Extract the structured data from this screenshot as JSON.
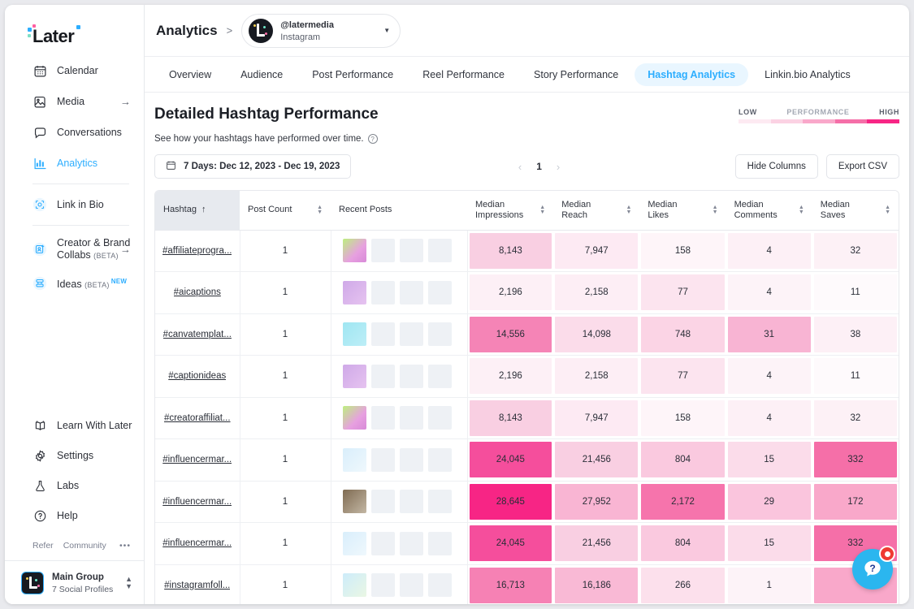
{
  "brand": {
    "logo_text": "Later",
    "accent": "#2daeff",
    "pink": "#f72585"
  },
  "sidebar": {
    "items": [
      {
        "label": "Calendar",
        "icon": "calendar-icon",
        "arrow": false,
        "active": false
      },
      {
        "label": "Media",
        "icon": "media-icon",
        "arrow": true,
        "active": false
      },
      {
        "label": "Conversations",
        "icon": "conversations-icon",
        "arrow": false,
        "active": false
      },
      {
        "label": "Analytics",
        "icon": "analytics-icon",
        "arrow": false,
        "active": true
      },
      {
        "label": "Link in Bio",
        "icon": "link-in-bio-icon",
        "arrow": false,
        "active": false
      },
      {
        "label": "Creator & Brand Collabs",
        "label2": "Collabs",
        "label1": "Creator & Brand",
        "badge": "(BETA)",
        "icon": "collabs-icon",
        "arrow": true,
        "active": false
      },
      {
        "label": "Ideas",
        "badge": "(BETA)",
        "new": "NEW",
        "icon": "ideas-icon",
        "arrow": false,
        "active": false
      }
    ],
    "bottom_items": [
      {
        "label": "Learn With Later",
        "icon": "book-icon"
      },
      {
        "label": "Settings",
        "icon": "gear-icon"
      },
      {
        "label": "Labs",
        "icon": "flask-icon"
      },
      {
        "label": "Help",
        "icon": "question-circle-icon"
      }
    ],
    "refer": "Refer",
    "community": "Community",
    "more_dots": "•••",
    "account": {
      "name": "Main Group",
      "subtitle": "7 Social Profiles"
    }
  },
  "header": {
    "breadcrumb_title": "Analytics",
    "breadcrumb_separator": ">",
    "account_handle": "@latermedia",
    "account_platform": "Instagram"
  },
  "tabs": [
    {
      "label": "Overview",
      "active": false
    },
    {
      "label": "Audience",
      "active": false
    },
    {
      "label": "Post Performance",
      "active": false
    },
    {
      "label": "Reel Performance",
      "active": false
    },
    {
      "label": "Story Performance",
      "active": false
    },
    {
      "label": "Hashtag Analytics",
      "active": true
    },
    {
      "label": "Linkin.bio Analytics",
      "active": false
    }
  ],
  "page": {
    "title": "Detailed Hashtag Performance",
    "subtitle": "See how your hashtags have performed over time.",
    "help_icon": "?",
    "legend": {
      "low": "LOW",
      "mid": "PERFORMANCE",
      "high": "HIGH",
      "swatches": [
        "#fdeaf2",
        "#fbd2e3",
        "#f9a8ca",
        "#f56fa8",
        "#f72585"
      ]
    },
    "date_range": "7 Days: Dec 12, 2023 - Dec 19, 2023",
    "pager": {
      "prev": "‹",
      "page": "1",
      "next": "›"
    },
    "hide_columns": "Hide Columns",
    "export_csv": "Export CSV"
  },
  "table": {
    "columns": [
      {
        "label": "Hashtag",
        "sort": "asc",
        "key": "hashtag"
      },
      {
        "label": "Post Count",
        "sort": "both",
        "key": "post_count"
      },
      {
        "label": "Recent Posts",
        "sort": "none",
        "key": "recent_posts"
      },
      {
        "label": "Median Impressions",
        "line1": "Median",
        "line2": "Impressions",
        "sort": "both",
        "key": "median_impressions"
      },
      {
        "label": "Median Reach",
        "line1": "Median",
        "line2": "Reach",
        "sort": "both",
        "key": "median_reach"
      },
      {
        "label": "Median Likes",
        "line1": "Median",
        "line2": "Likes",
        "sort": "both",
        "key": "median_likes"
      },
      {
        "label": "Median Comments",
        "line1": "Median",
        "line2": "Comments",
        "sort": "both",
        "key": "median_comments"
      },
      {
        "label": "Median Saves",
        "line1": "Median",
        "line2": "Saves",
        "sort": "both",
        "key": "median_saves"
      }
    ],
    "rows": [
      {
        "hashtag": "#affiliateprogra...",
        "post_count": "1",
        "thumb": "t1",
        "median_impressions": "8,143",
        "mi_c": "#f9cfe2",
        "median_reach": "7,947",
        "mr_c": "#fdeaf3",
        "median_likes": "158",
        "ml_c": "#fef5f9",
        "median_comments": "4",
        "mc_c": "#fdf0f6",
        "median_saves": "32",
        "ms_c": "#fdf1f6"
      },
      {
        "hashtag": "#aicaptions",
        "post_count": "1",
        "thumb": "t2",
        "median_impressions": "2,196",
        "mi_c": "#fdf0f6",
        "median_reach": "2,158",
        "mr_c": "#fdeef5",
        "median_likes": "77",
        "ml_c": "#fce4ef",
        "median_comments": "4",
        "mc_c": "#fdf3f8",
        "median_saves": "11",
        "ms_c": "#fefafc"
      },
      {
        "hashtag": "#canvatemplat...",
        "post_count": "1",
        "thumb": "t3",
        "median_impressions": "14,556",
        "mi_c": "#f584b6",
        "median_reach": "14,098",
        "mr_c": "#fbdcea",
        "median_likes": "748",
        "ml_c": "#fbd4e5",
        "median_comments": "31",
        "mc_c": "#f8b4d3",
        "median_saves": "38",
        "ms_c": "#fdf0f6"
      },
      {
        "hashtag": "#captionideas",
        "post_count": "1",
        "thumb": "t2",
        "median_impressions": "2,196",
        "mi_c": "#fdf0f6",
        "median_reach": "2,158",
        "mr_c": "#fdeef5",
        "median_likes": "77",
        "ml_c": "#fce4ef",
        "median_comments": "4",
        "mc_c": "#fdf3f8",
        "median_saves": "11",
        "ms_c": "#fefafc"
      },
      {
        "hashtag": "#creatoraffiliat...",
        "post_count": "1",
        "thumb": "t1",
        "median_impressions": "8,143",
        "mi_c": "#f9cfe2",
        "median_reach": "7,947",
        "mr_c": "#fdeaf3",
        "median_likes": "158",
        "ml_c": "#fef5f9",
        "median_comments": "4",
        "mc_c": "#fdf0f6",
        "median_saves": "32",
        "ms_c": "#fdf1f6"
      },
      {
        "hashtag": "#influencermar...",
        "post_count": "1",
        "thumb": "t4",
        "median_impressions": "24,045",
        "mi_c": "#f54e9c",
        "median_reach": "21,456",
        "mr_c": "#f9cfe2",
        "median_likes": "804",
        "ml_c": "#fac9df",
        "median_comments": "15",
        "mc_c": "#fbdcea",
        "median_saves": "332",
        "ms_c": "#f56fa8"
      },
      {
        "hashtag": "#influencermar...",
        "post_count": "1",
        "thumb": "t5",
        "median_impressions": "28,645",
        "mi_c": "#f72585",
        "median_reach": "27,952",
        "mr_c": "#f9b5d3",
        "median_likes": "2,172",
        "ml_c": "#f674ac",
        "median_comments": "29",
        "mc_c": "#fac5dd",
        "median_saves": "172",
        "ms_c": "#f9a8ca"
      },
      {
        "hashtag": "#influencermar...",
        "post_count": "1",
        "thumb": "t4",
        "median_impressions": "24,045",
        "mi_c": "#f54e9c",
        "median_reach": "21,456",
        "mr_c": "#f9cfe2",
        "median_likes": "804",
        "ml_c": "#fac9df",
        "median_comments": "15",
        "mc_c": "#fbdcea",
        "median_saves": "332",
        "ms_c": "#f56fa8"
      },
      {
        "hashtag": "#instagramfoll...",
        "post_count": "1",
        "thumb": "t6",
        "median_impressions": "16,713",
        "mi_c": "#f681b4",
        "median_reach": "16,186",
        "mr_c": "#f9b9d5",
        "median_likes": "266",
        "ml_c": "#fce0ec",
        "median_comments": "1",
        "mc_c": "#fdf3f8",
        "median_saves": "",
        "ms_c": "#f9a8ca"
      }
    ]
  },
  "help_fab": {
    "icon": "question-chat-icon",
    "has_badge": true
  }
}
